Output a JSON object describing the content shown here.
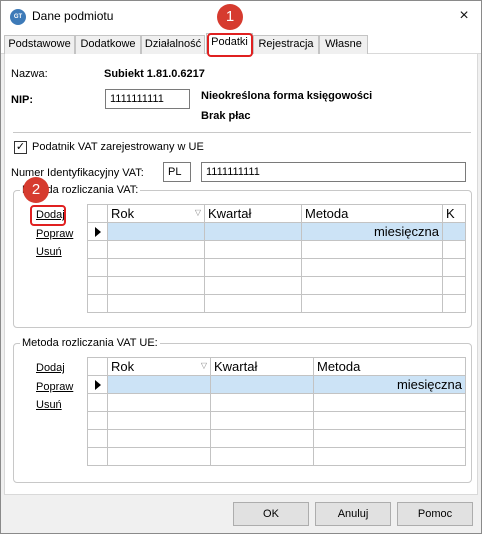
{
  "window": {
    "title": "Dane podmiotu",
    "close_glyph": "×"
  },
  "tabs": [
    "Podstawowe",
    "Dodatkowe",
    "Działalność",
    "Podatki",
    "Rejestracja",
    "Własne"
  ],
  "active_tab": "Podatki",
  "info": {
    "name_label": "Nazwa:",
    "name_value": "Subiekt 1.81.0.6217",
    "nip_label": "NIP:",
    "nip_value": "1111111111",
    "tax_form": "Nieokreślona forma księgowości",
    "payment": "Brak płac"
  },
  "vat_ue": {
    "checkbox_label": "Podatnik VAT zarejestrowany w UE",
    "checked": true,
    "id_label": "Numer Identyfikacyjny VAT:",
    "country": "PL",
    "number": "1111111111"
  },
  "vat_group": {
    "title": "Metoda rozliczania VAT:",
    "links": {
      "add": "Dodaj",
      "edit": "Popraw",
      "delete": "Usuń"
    },
    "columns": [
      "Rok",
      "Kwartał",
      "Metoda",
      "K"
    ],
    "selected_value": "miesięczna"
  },
  "vat_ue_group": {
    "title": "Metoda rozliczania VAT UE:",
    "links": {
      "add": "Dodaj",
      "edit": "Popraw",
      "delete": "Usuń"
    },
    "columns": [
      "Rok",
      "Kwartał",
      "Metoda"
    ],
    "selected_value": "miesięczna"
  },
  "buttons": {
    "ok": "OK",
    "cancel": "Anuluj",
    "help": "Pomoc"
  },
  "callouts": [
    "1",
    "2"
  ],
  "colors": {
    "selection": "#cce3f6",
    "callout": "#d63b2f"
  }
}
